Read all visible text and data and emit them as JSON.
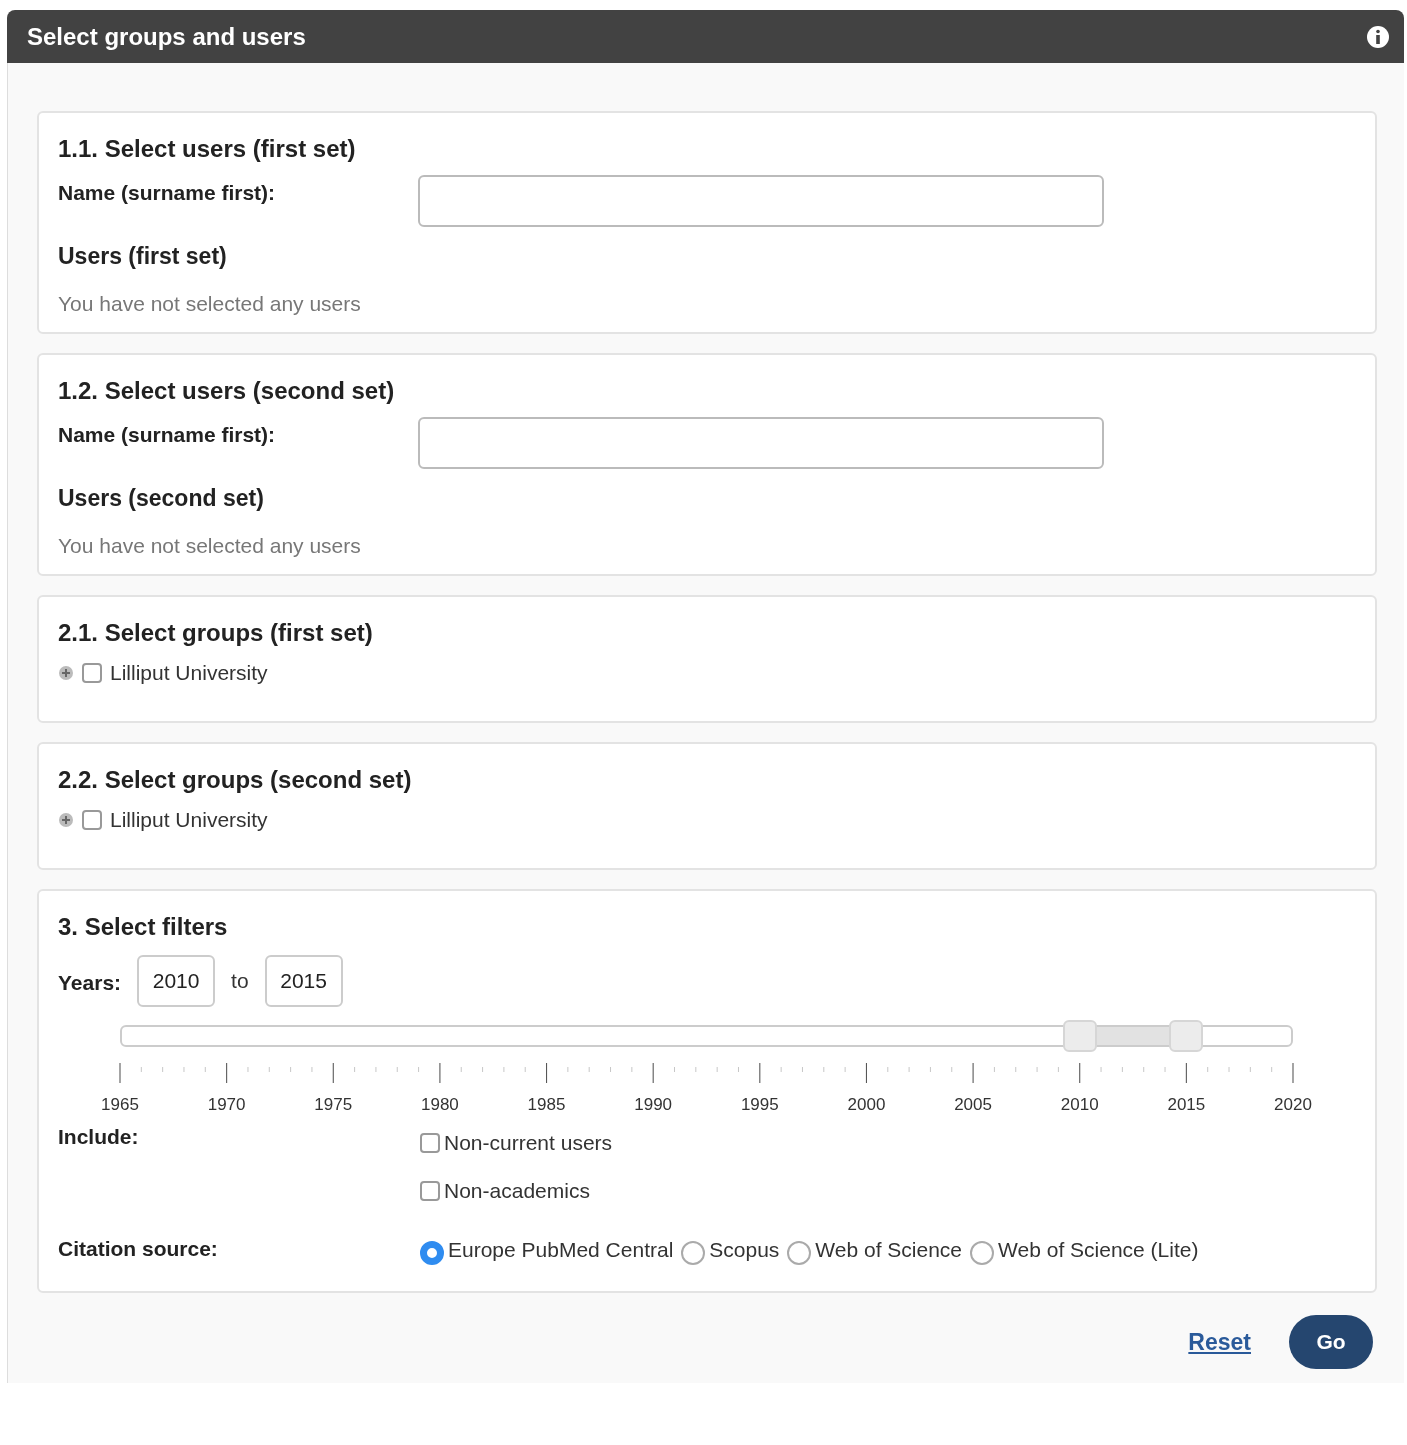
{
  "header": {
    "title": "Select groups and users"
  },
  "user_sections": [
    {
      "heading": "1.1. Select users (first set)",
      "name_label": "Name (surname first):",
      "list_heading": "Users (first set)",
      "empty_message": "You have not selected any users"
    },
    {
      "heading": "1.2. Select users (second set)",
      "name_label": "Name (surname first):",
      "list_heading": "Users (second set)",
      "empty_message": "You have not selected any users"
    }
  ],
  "group_sections": [
    {
      "heading": "2.1. Select groups (first set)",
      "groups": [
        {
          "label": "Lilliput University",
          "checked": false,
          "expanded": false
        }
      ]
    },
    {
      "heading": "2.2. Select groups (second set)",
      "groups": [
        {
          "label": "Lilliput University",
          "checked": false,
          "expanded": false
        }
      ]
    }
  ],
  "filters": {
    "heading": "3. Select filters",
    "years_label": "Years:",
    "from": "2010",
    "to_label": "to",
    "to": "2015",
    "slider": {
      "thumbs": [
        {
          "level": 0.818
        },
        {
          "level": 0.909
        }
      ],
      "tick_labels": [
        "1965",
        "1970",
        "1975",
        "1980",
        "1985",
        "1990",
        "1995",
        "2000",
        "2005",
        "2010",
        "2015",
        "2020"
      ]
    },
    "include_label": "Include:",
    "include_options": [
      {
        "label": "Non-current users",
        "checked": false
      },
      {
        "label": "Non-academics",
        "checked": false
      }
    ],
    "citation_label": "Citation source:",
    "citation_options": [
      {
        "label": "Europe PubMed Central",
        "selected": true
      },
      {
        "label": "Scopus",
        "selected": false
      },
      {
        "label": "Web of Science",
        "selected": false
      },
      {
        "label": "Web of Science (Lite)",
        "selected": false
      }
    ]
  },
  "actions": {
    "reset": "Reset",
    "go": "Go"
  }
}
